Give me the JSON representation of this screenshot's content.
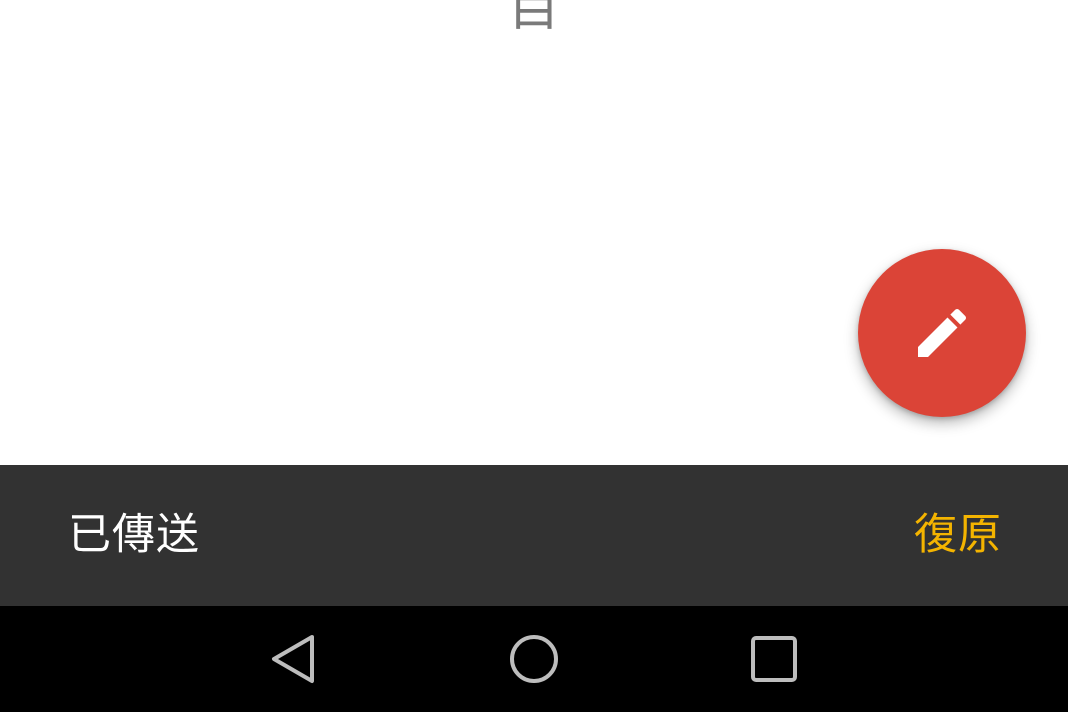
{
  "content": {
    "partial_glyph": "目"
  },
  "fab": {
    "icon": "pencil-icon",
    "color": "#DB4437"
  },
  "snackbar": {
    "message": "已傳送",
    "action_label": "復原",
    "action_color": "#F4B400"
  },
  "navbar": {
    "back_icon": "back-triangle-icon",
    "home_icon": "home-circle-icon",
    "recents_icon": "recents-square-icon"
  }
}
